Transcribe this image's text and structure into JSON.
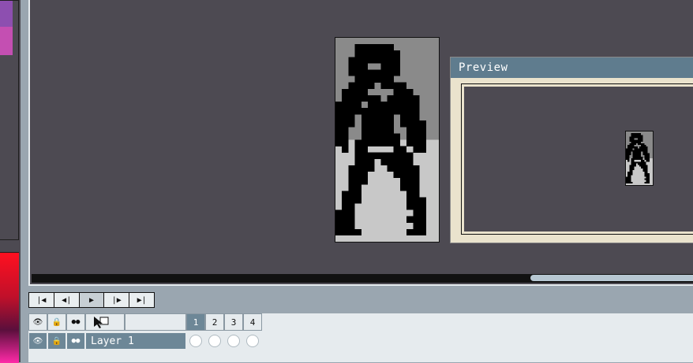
{
  "preview": {
    "title": "Preview"
  },
  "playback": {
    "buttons": [
      {
        "name": "first-frame-button",
        "glyph": "|◀"
      },
      {
        "name": "prev-frame-button",
        "glyph": "◀|"
      },
      {
        "name": "play-button",
        "glyph": "▶"
      },
      {
        "name": "next-frame-button",
        "glyph": "|▶"
      },
      {
        "name": "last-frame-button",
        "glyph": "▶|"
      }
    ]
  },
  "layers": {
    "header_icons": {
      "eye": "👁",
      "lock": "🔒",
      "link": "●●"
    },
    "frames": [
      "1",
      "2",
      "3",
      "4"
    ],
    "items": [
      {
        "name": "Layer 1"
      }
    ]
  },
  "colors": {
    "canvas_bg": "#4d4a52",
    "panel": "#9aa6b0",
    "titlebar": "#5f7c8e",
    "selected_row": "#6d8797",
    "sprite_top": "#8a8a8a",
    "sprite_bottom": "#c8c8c8",
    "sprite_ink": "#000000"
  }
}
